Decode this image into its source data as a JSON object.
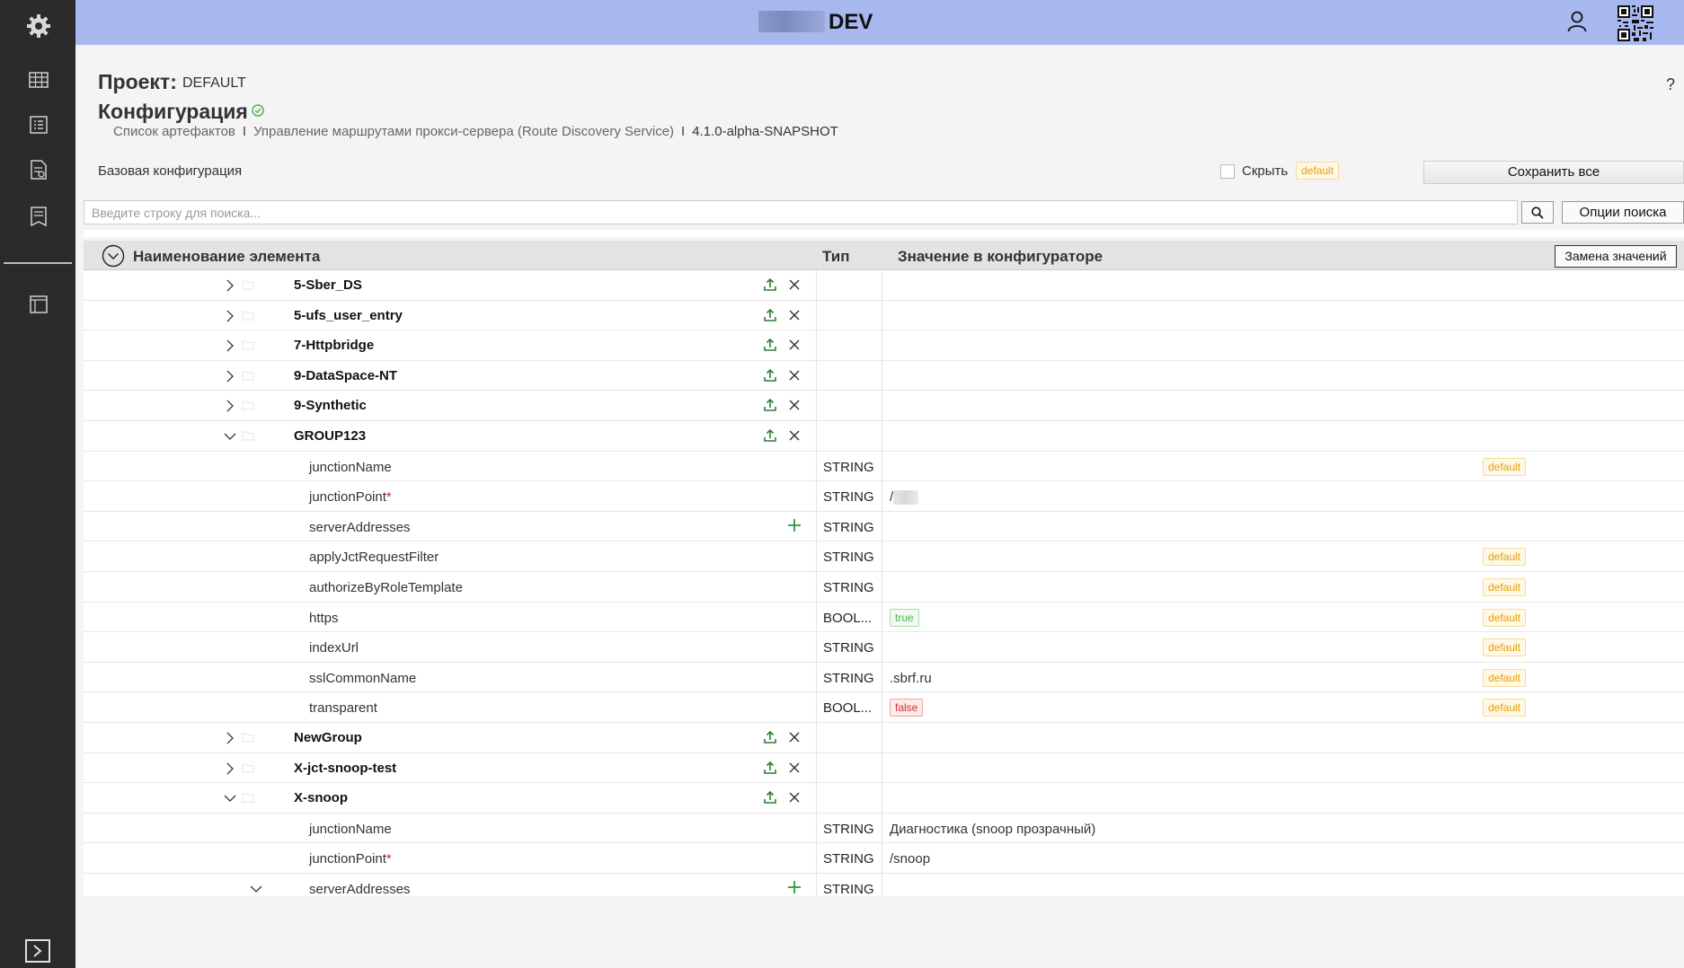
{
  "app": {
    "title": "DEV"
  },
  "page": {
    "project_label": "Проект:",
    "project_value": "DEFAULT",
    "config_title": "Конфигурация",
    "help": "?",
    "breadcrumb": {
      "items": [
        "Список артефактов",
        "Управление маршрутами прокси-сервера (Route Discovery Service)",
        "4.1.0-alpha-SNAPSHOT"
      ],
      "separator": "I"
    },
    "base_config": "Базовая конфигурация",
    "hide_label": "Скрыть",
    "hide_checked": false,
    "hide_badge": "default",
    "save_all": "Сохранить все"
  },
  "search": {
    "placeholder": "Введите строку для поиска...",
    "value": "",
    "options_label": "Опции поиска"
  },
  "table": {
    "headers": {
      "name": "Наименование элемента",
      "type": "Тип",
      "value": "Значение в конфигураторе"
    },
    "replace_button": "Замена значений",
    "rows": [
      {
        "kind": "group",
        "name": "5-Sber_DS",
        "expanded": false,
        "indent": 0
      },
      {
        "kind": "group",
        "name": "5-ufs_user_entry",
        "expanded": false,
        "indent": 0
      },
      {
        "kind": "group",
        "name": "7-Httpbridge",
        "expanded": false,
        "indent": 0
      },
      {
        "kind": "group",
        "name": "9-DataSpace-NT",
        "expanded": false,
        "indent": 0
      },
      {
        "kind": "group",
        "name": "9-Synthetic",
        "expanded": false,
        "indent": 0
      },
      {
        "kind": "group",
        "name": "GROUP123",
        "expanded": true,
        "indent": 0
      },
      {
        "kind": "param",
        "name": "junctionName",
        "required": false,
        "type": "STRING",
        "value": "",
        "default": "default"
      },
      {
        "kind": "param",
        "name": "junctionPoint",
        "required": true,
        "type": "STRING",
        "value": "/",
        "blurred": true
      },
      {
        "kind": "param",
        "name": "serverAddresses",
        "required": false,
        "type": "STRING",
        "value": "",
        "addable": true
      },
      {
        "kind": "param",
        "name": "applyJctRequestFilter",
        "required": false,
        "type": "STRING",
        "value": "",
        "default": "default"
      },
      {
        "kind": "param",
        "name": "authorizeByRoleTemplate",
        "required": false,
        "type": "STRING",
        "value": "",
        "default": "default"
      },
      {
        "kind": "param",
        "name": "https",
        "required": false,
        "type": "BOOL...",
        "value_badge": "true",
        "value_badge_kind": "true",
        "default": "default"
      },
      {
        "kind": "param",
        "name": "indexUrl",
        "required": false,
        "type": "STRING",
        "value": "",
        "default": "default"
      },
      {
        "kind": "param",
        "name": "sslCommonName",
        "required": false,
        "type": "STRING",
        "value": ".sbrf.ru",
        "default": "default"
      },
      {
        "kind": "param",
        "name": "transparent",
        "required": false,
        "type": "BOOL...",
        "value_badge": "false",
        "value_badge_kind": "false",
        "default": "default"
      },
      {
        "kind": "group",
        "name": "NewGroup",
        "expanded": false,
        "indent": 0
      },
      {
        "kind": "group",
        "name": "X-jct-snoop-test",
        "expanded": false,
        "indent": 0
      },
      {
        "kind": "group",
        "name": "X-snoop",
        "expanded": true,
        "indent": 0
      },
      {
        "kind": "param",
        "name": "junctionName",
        "required": false,
        "type": "STRING",
        "value": "Диагностика (snoop прозрачный)"
      },
      {
        "kind": "param",
        "name": "junctionPoint",
        "required": true,
        "type": "STRING",
        "value": "/snoop"
      },
      {
        "kind": "param",
        "name": "serverAddresses",
        "required": false,
        "type": "STRING",
        "value": "",
        "addable": true,
        "expandable": true
      }
    ]
  },
  "icons": {
    "sidebar": [
      "gear-icon",
      "table-icon",
      "list-icon",
      "report-icon",
      "document-icon",
      "layout-icon",
      "console-icon"
    ],
    "topbar": [
      "user-icon",
      "qr-code-icon"
    ]
  },
  "colors": {
    "topbar": "#a7b8ee",
    "sidebar": "#2b2b2b",
    "upload_icon": "#2e7d32",
    "default_badge": "#e6a100",
    "true_badge": "#4caf50",
    "false_badge": "#d32f2f"
  }
}
